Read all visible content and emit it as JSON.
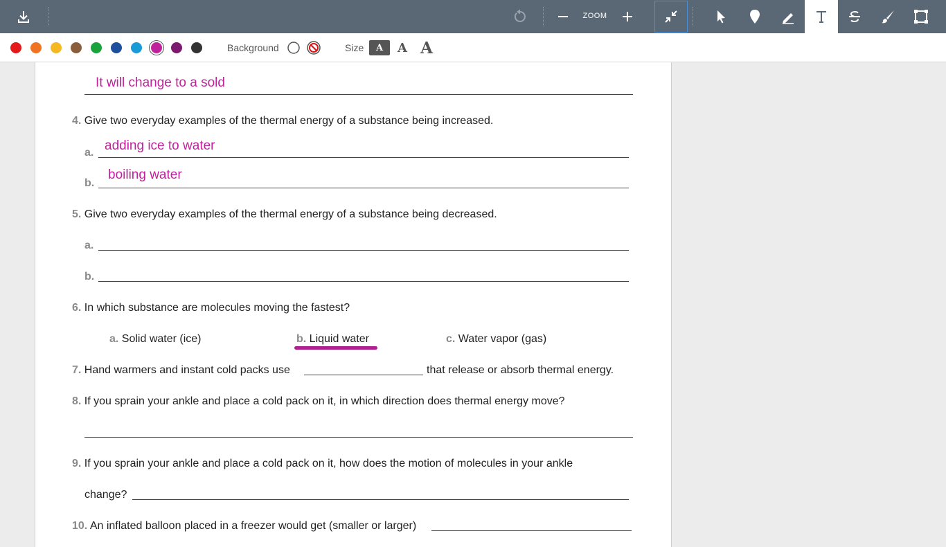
{
  "toolbar": {
    "zoom_label": "ZOOM",
    "icons": [
      "download-icon",
      "undo-icon",
      "zoom-out-icon",
      "zoom-in-icon",
      "collapse-icon",
      "pointer-icon",
      "pin-icon",
      "pencil-icon",
      "text-icon",
      "strikethrough-icon",
      "brush-icon",
      "crop-icon"
    ]
  },
  "palette": {
    "colors": [
      "#e3191b",
      "#f07323",
      "#f5b722",
      "#8a5e3a",
      "#1aa33c",
      "#1d4f9c",
      "#1a9ad6",
      "#c0229c",
      "#7b1a6e",
      "#333333"
    ],
    "selected": "#c0229c",
    "background_label": "Background",
    "size_label": "Size",
    "size_options": [
      "A",
      "A",
      "A"
    ]
  },
  "worksheet": {
    "answer_q3": "It will change to a sold",
    "q4": {
      "num": "4.",
      "text": "Give two everyday examples of the thermal energy of a substance being increased.",
      "a_label": "a.",
      "b_label": "b.",
      "a_answer": "adding ice to water",
      "b_answer": "boiling water"
    },
    "q5": {
      "num": "5.",
      "text": "Give two everyday examples of the thermal energy of a substance being decreased.",
      "a_label": "a.",
      "b_label": "b."
    },
    "q6": {
      "num": "6.",
      "text": "In which substance are molecules moving the fastest?",
      "options": [
        {
          "label": "a.",
          "text": "Solid water (ice)"
        },
        {
          "label": "b.",
          "text": "Liquid water"
        },
        {
          "label": "c.",
          "text": "Water vapor (gas)"
        }
      ]
    },
    "q7": {
      "num": "7.",
      "text_before": "Hand warmers and instant cold packs use",
      "text_after": "that release or absorb thermal energy."
    },
    "q8": {
      "num": "8.",
      "text": "If you sprain your ankle and place a cold pack on it, in which direction does thermal energy move?"
    },
    "q9": {
      "num": "9.",
      "text": "If you sprain your ankle and place a cold pack on it, how does the motion of molecules in your ankle",
      "text_cont": "change?"
    },
    "q10": {
      "num": "10.",
      "text": "An inflated balloon placed in a freezer would get (smaller or larger)"
    }
  }
}
